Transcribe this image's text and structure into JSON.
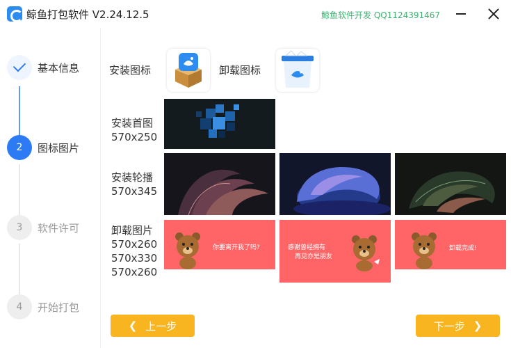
{
  "titlebar": {
    "title": "鲸鱼打包软件 V2.24.12.5",
    "developer": "鲸鱼软件开发 QQ1124391467"
  },
  "steps": [
    {
      "number": "1",
      "label": "基本信息",
      "state": "done"
    },
    {
      "number": "2",
      "label": "图标图片",
      "state": "active"
    },
    {
      "number": "3",
      "label": "软件许可",
      "state": "todo"
    },
    {
      "number": "4",
      "label": "开始打包",
      "state": "todo"
    }
  ],
  "icons": {
    "install_label": "安装图标",
    "uninstall_label": "卸载图标"
  },
  "install_home": {
    "label_1": "安装首图",
    "label_2": "570x250"
  },
  "install_carousel": {
    "label_1": "安装轮播",
    "label_2": "570x345"
  },
  "uninstall_images": {
    "label_1": "卸载图片",
    "label_2": "570x260",
    "label_3": "570x330",
    "label_4": "570x260",
    "texts": [
      "你要离开我了吗?",
      "感谢曾经拥有",
      "再见亦是朋友",
      "卸载完成!"
    ]
  },
  "buttons": {
    "prev": "上一步",
    "next": "下一步"
  },
  "colors": {
    "accent": "#2d7bf4",
    "button": "#f8b51f",
    "uninstall_bg": "#ff6567",
    "developer_text": "#3cb371"
  }
}
